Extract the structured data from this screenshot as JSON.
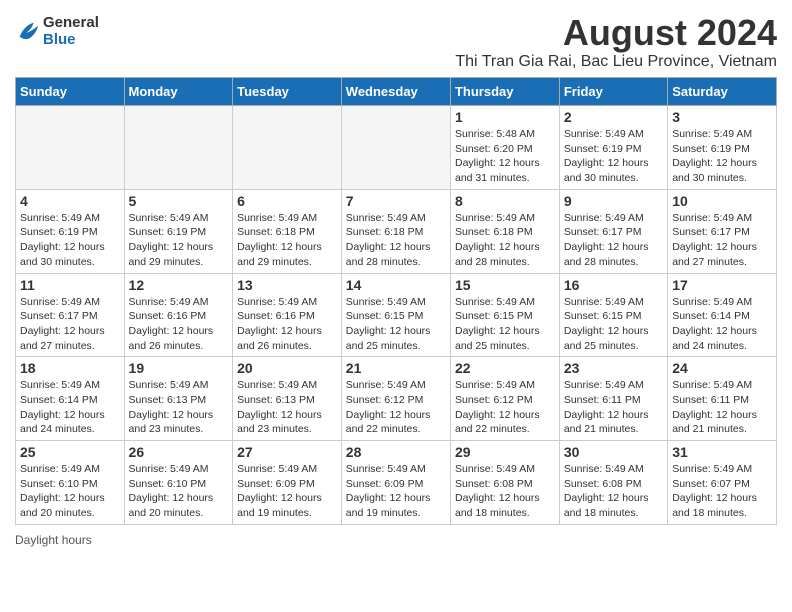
{
  "header": {
    "logo_line1": "General",
    "logo_line2": "Blue",
    "month_year": "August 2024",
    "subtitle": "Thi Tran Gia Rai, Bac Lieu Province, Vietnam"
  },
  "days_of_week": [
    "Sunday",
    "Monday",
    "Tuesday",
    "Wednesday",
    "Thursday",
    "Friday",
    "Saturday"
  ],
  "footer": {
    "daylight_hours_label": "Daylight hours"
  },
  "weeks": [
    {
      "days": [
        {
          "number": "",
          "info": ""
        },
        {
          "number": "",
          "info": ""
        },
        {
          "number": "",
          "info": ""
        },
        {
          "number": "",
          "info": ""
        },
        {
          "number": "1",
          "info": "Sunrise: 5:48 AM\nSunset: 6:20 PM\nDaylight: 12 hours\nand 31 minutes."
        },
        {
          "number": "2",
          "info": "Sunrise: 5:49 AM\nSunset: 6:19 PM\nDaylight: 12 hours\nand 30 minutes."
        },
        {
          "number": "3",
          "info": "Sunrise: 5:49 AM\nSunset: 6:19 PM\nDaylight: 12 hours\nand 30 minutes."
        }
      ]
    },
    {
      "days": [
        {
          "number": "4",
          "info": "Sunrise: 5:49 AM\nSunset: 6:19 PM\nDaylight: 12 hours\nand 30 minutes."
        },
        {
          "number": "5",
          "info": "Sunrise: 5:49 AM\nSunset: 6:19 PM\nDaylight: 12 hours\nand 29 minutes."
        },
        {
          "number": "6",
          "info": "Sunrise: 5:49 AM\nSunset: 6:18 PM\nDaylight: 12 hours\nand 29 minutes."
        },
        {
          "number": "7",
          "info": "Sunrise: 5:49 AM\nSunset: 6:18 PM\nDaylight: 12 hours\nand 28 minutes."
        },
        {
          "number": "8",
          "info": "Sunrise: 5:49 AM\nSunset: 6:18 PM\nDaylight: 12 hours\nand 28 minutes."
        },
        {
          "number": "9",
          "info": "Sunrise: 5:49 AM\nSunset: 6:17 PM\nDaylight: 12 hours\nand 28 minutes."
        },
        {
          "number": "10",
          "info": "Sunrise: 5:49 AM\nSunset: 6:17 PM\nDaylight: 12 hours\nand 27 minutes."
        }
      ]
    },
    {
      "days": [
        {
          "number": "11",
          "info": "Sunrise: 5:49 AM\nSunset: 6:17 PM\nDaylight: 12 hours\nand 27 minutes."
        },
        {
          "number": "12",
          "info": "Sunrise: 5:49 AM\nSunset: 6:16 PM\nDaylight: 12 hours\nand 26 minutes."
        },
        {
          "number": "13",
          "info": "Sunrise: 5:49 AM\nSunset: 6:16 PM\nDaylight: 12 hours\nand 26 minutes."
        },
        {
          "number": "14",
          "info": "Sunrise: 5:49 AM\nSunset: 6:15 PM\nDaylight: 12 hours\nand 25 minutes."
        },
        {
          "number": "15",
          "info": "Sunrise: 5:49 AM\nSunset: 6:15 PM\nDaylight: 12 hours\nand 25 minutes."
        },
        {
          "number": "16",
          "info": "Sunrise: 5:49 AM\nSunset: 6:15 PM\nDaylight: 12 hours\nand 25 minutes."
        },
        {
          "number": "17",
          "info": "Sunrise: 5:49 AM\nSunset: 6:14 PM\nDaylight: 12 hours\nand 24 minutes."
        }
      ]
    },
    {
      "days": [
        {
          "number": "18",
          "info": "Sunrise: 5:49 AM\nSunset: 6:14 PM\nDaylight: 12 hours\nand 24 minutes."
        },
        {
          "number": "19",
          "info": "Sunrise: 5:49 AM\nSunset: 6:13 PM\nDaylight: 12 hours\nand 23 minutes."
        },
        {
          "number": "20",
          "info": "Sunrise: 5:49 AM\nSunset: 6:13 PM\nDaylight: 12 hours\nand 23 minutes."
        },
        {
          "number": "21",
          "info": "Sunrise: 5:49 AM\nSunset: 6:12 PM\nDaylight: 12 hours\nand 22 minutes."
        },
        {
          "number": "22",
          "info": "Sunrise: 5:49 AM\nSunset: 6:12 PM\nDaylight: 12 hours\nand 22 minutes."
        },
        {
          "number": "23",
          "info": "Sunrise: 5:49 AM\nSunset: 6:11 PM\nDaylight: 12 hours\nand 21 minutes."
        },
        {
          "number": "24",
          "info": "Sunrise: 5:49 AM\nSunset: 6:11 PM\nDaylight: 12 hours\nand 21 minutes."
        }
      ]
    },
    {
      "days": [
        {
          "number": "25",
          "info": "Sunrise: 5:49 AM\nSunset: 6:10 PM\nDaylight: 12 hours\nand 20 minutes."
        },
        {
          "number": "26",
          "info": "Sunrise: 5:49 AM\nSunset: 6:10 PM\nDaylight: 12 hours\nand 20 minutes."
        },
        {
          "number": "27",
          "info": "Sunrise: 5:49 AM\nSunset: 6:09 PM\nDaylight: 12 hours\nand 19 minutes."
        },
        {
          "number": "28",
          "info": "Sunrise: 5:49 AM\nSunset: 6:09 PM\nDaylight: 12 hours\nand 19 minutes."
        },
        {
          "number": "29",
          "info": "Sunrise: 5:49 AM\nSunset: 6:08 PM\nDaylight: 12 hours\nand 18 minutes."
        },
        {
          "number": "30",
          "info": "Sunrise: 5:49 AM\nSunset: 6:08 PM\nDaylight: 12 hours\nand 18 minutes."
        },
        {
          "number": "31",
          "info": "Sunrise: 5:49 AM\nSunset: 6:07 PM\nDaylight: 12 hours\nand 18 minutes."
        }
      ]
    }
  ]
}
